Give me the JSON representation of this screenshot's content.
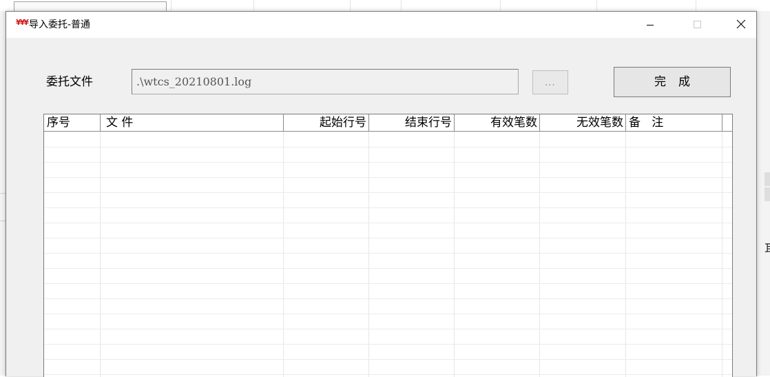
{
  "dialog": {
    "title": "导入委托-普通",
    "icon": "app-logo-icon",
    "icon_glyph": "¥¥¥",
    "window_controls": {
      "minimize_icon": "minimize-icon",
      "maximize_icon": "maximize-icon",
      "close_icon": "close-icon",
      "close_glyph": "✕"
    }
  },
  "form": {
    "file_label": "委托文件",
    "file_value": ".\\wtcs_20210801.log",
    "browse_label": "...",
    "done_label": "完成"
  },
  "grid": {
    "columns": [
      {
        "key": "seq",
        "label": "序号"
      },
      {
        "key": "file",
        "label": "文 件"
      },
      {
        "key": "start_line",
        "label": "起始行号"
      },
      {
        "key": "end_line",
        "label": "结束行号"
      },
      {
        "key": "valid_count",
        "label": "有效笔数"
      },
      {
        "key": "invalid_count",
        "label": "无效笔数"
      },
      {
        "key": "remark",
        "label": "备   注"
      }
    ],
    "rows": []
  },
  "colors": {
    "dialog_bg": "#f0f0f0",
    "titlebar_bg": "#ffffff",
    "icon_red": "#d01818",
    "grid_bg": "#ffffff"
  }
}
